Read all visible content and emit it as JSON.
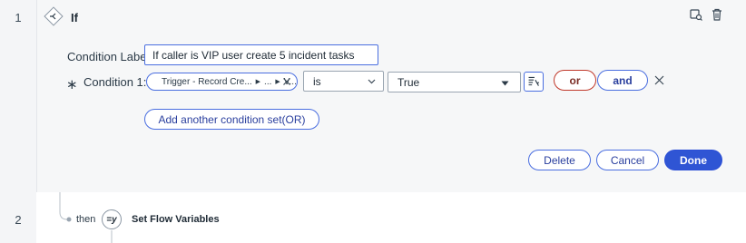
{
  "rows": {
    "first_number": "1",
    "second_number": "2"
  },
  "if_block": {
    "title": "If",
    "condition_label_caption": "Condition Label:",
    "condition_label_value": "If caller is VIP user create 5 incident tasks",
    "required_marker": "∗",
    "condition_caption": "Condition 1:",
    "data_pill": {
      "segment1": "Trigger - Record Cre...",
      "segment2": "...",
      "segment3": "V..."
    },
    "operator_value": "is",
    "value_select": "True",
    "or_label": "or",
    "and_label": "and",
    "add_condition_set_label": "Add another condition set(OR)",
    "delete_label": "Delete",
    "cancel_label": "Cancel",
    "done_label": "Done"
  },
  "next_step": {
    "then_label": "then",
    "icon_text": "=y",
    "title": "Set Flow Variables"
  },
  "icons": {
    "if": "branch-diamond-icon",
    "view": "view-details-icon",
    "delete": "trash-icon",
    "clear_pill": "close-icon",
    "picker": "data-picker-icon",
    "remove_condition": "close-icon"
  },
  "colors": {
    "primary": "#2f55d4",
    "or_border": "#c0392b",
    "panel_bg": "#f6f7f8"
  }
}
